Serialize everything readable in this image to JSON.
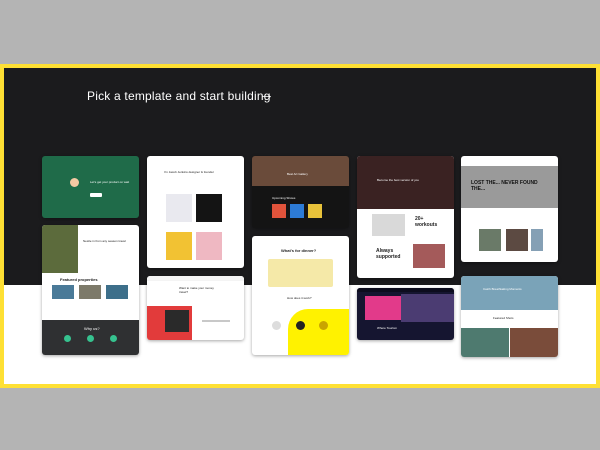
{
  "header": {
    "title": "Pick a template and start building",
    "arrow_glyph": "→"
  },
  "colors": {
    "frame": "#fee034",
    "dark_band": "#1b1b1d",
    "light_band": "#ffffff",
    "page": "#b4b4b4"
  },
  "templates": {
    "t1": {
      "headline": "Let's get your product on wait",
      "badge": ""
    },
    "t2": {
      "headline": "Nestle in from any season travel",
      "section": "Featured properties",
      "cta": "Why us?"
    },
    "t3": {
      "headline": "I'm Jacob Jenkins designer & founder"
    },
    "t4": {
      "headline": "Best Art Gallery",
      "section": "Upcoming Shows"
    },
    "t5": {
      "headline": "Become the best version of you",
      "stat": "20+ workouts",
      "sub": "Always supported"
    },
    "t6": {
      "headline": "LOST THE... NEVER FOUND THE..."
    },
    "t7": {
      "headline": "What's for dinner?",
      "sub": "How does it work?"
    },
    "t8": {
      "headline": "Want to make your money travel?"
    },
    "t9": {
      "headline": "Where Tourism"
    },
    "t10": {
      "headline": "Catch Breathtaking Moments",
      "section": "Featured Shots"
    }
  }
}
